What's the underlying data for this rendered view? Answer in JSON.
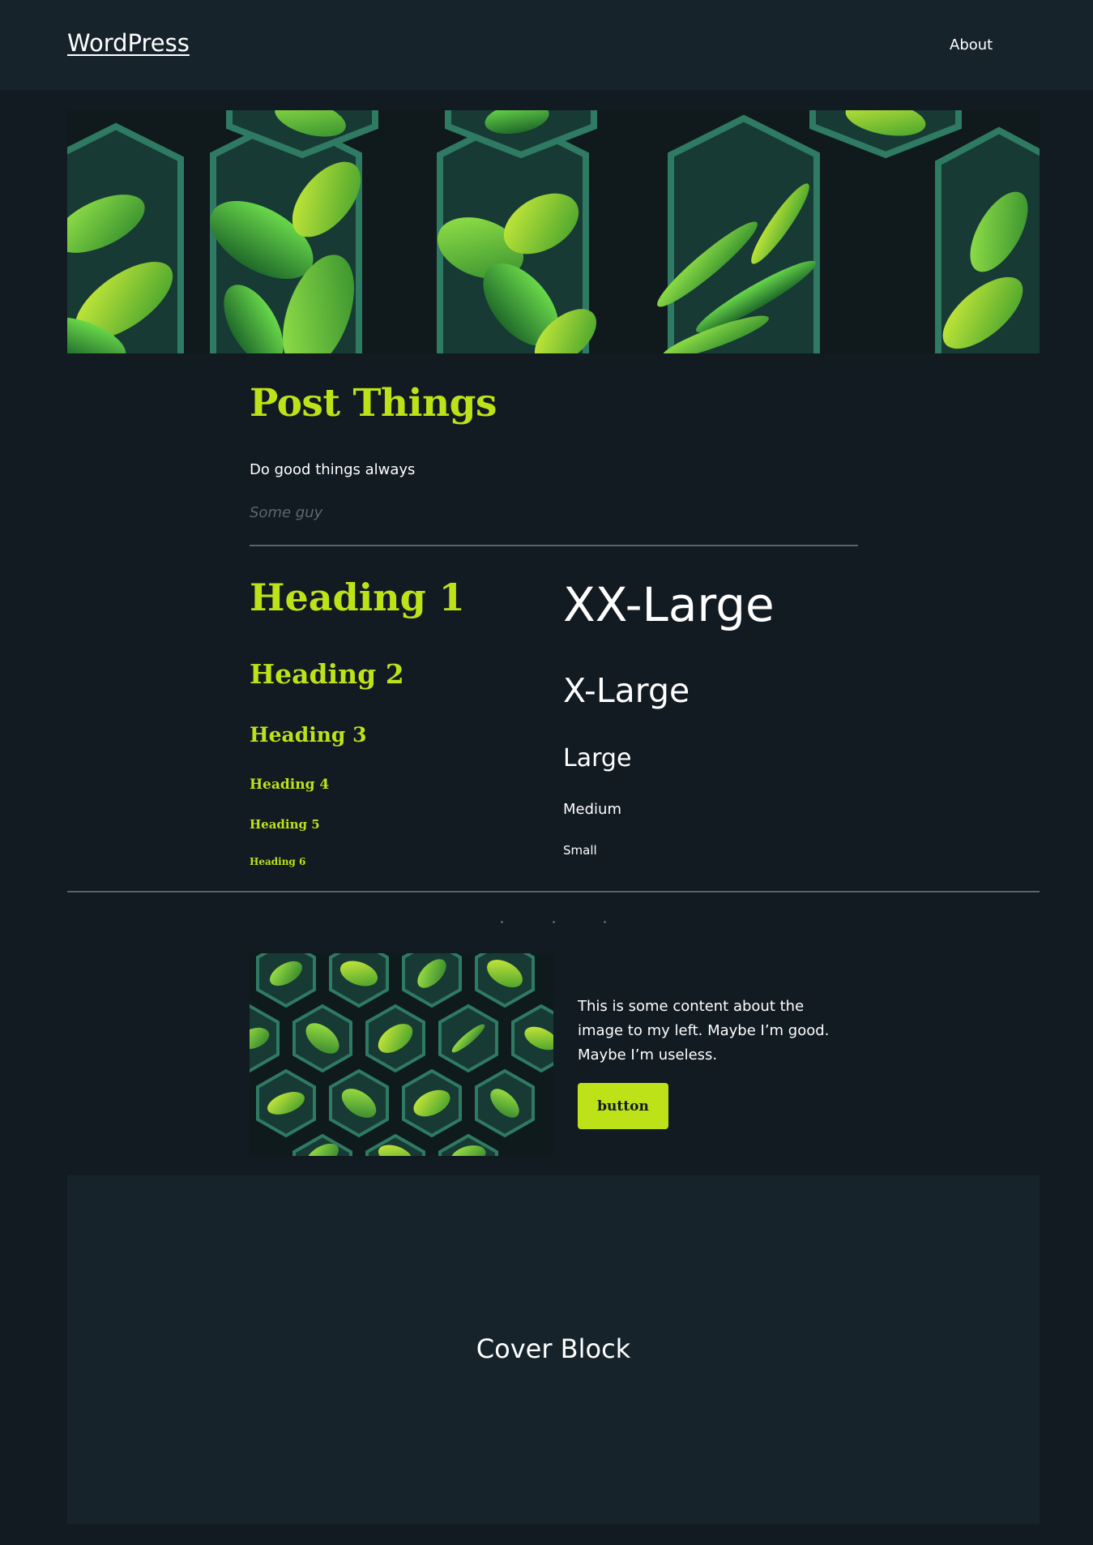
{
  "header": {
    "site_title": "WordPress",
    "nav": [
      {
        "label": "About"
      }
    ]
  },
  "hero": {
    "image": "green-leaves-hexagon-banner"
  },
  "post": {
    "title": "Post Things",
    "quote": {
      "text": "Do good things always",
      "cite": "Some guy"
    }
  },
  "headings": [
    "Heading 1",
    "Heading 2",
    "Heading 3",
    "Heading 4",
    "Heading 5",
    "Heading 6"
  ],
  "font_sizes": [
    "XX-Large",
    "X-Large",
    "Large",
    "Medium",
    "Small"
  ],
  "media_text": {
    "image": "green-leaves-hexagon-grid",
    "text": "This is some content about the image to my left. Maybe I’m good. Maybe I’m useless.",
    "button_label": "button"
  },
  "cover": {
    "title": "Cover Block"
  },
  "colors": {
    "background": "#121a22",
    "header_background": "#17232b",
    "accent": "#bde318",
    "text": "#ffffff",
    "muted": "#5c6670",
    "separator": "#5a636b"
  }
}
